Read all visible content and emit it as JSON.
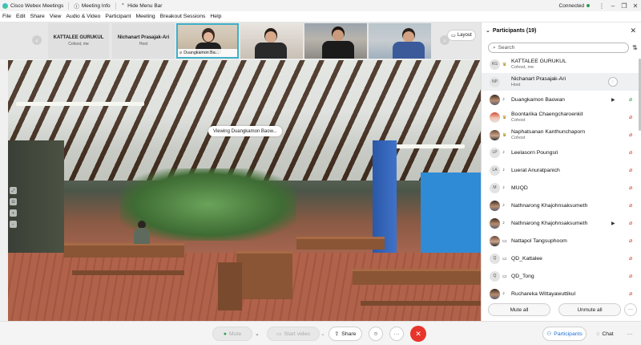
{
  "titlebar": {
    "app_title": "Cisco Webex Meetings",
    "meeting_info": "Meeting Info",
    "hide_menu_bar": "Hide Menu Bar",
    "connection_status": "Connected"
  },
  "menubar": {
    "items": [
      "File",
      "Edit",
      "Share",
      "View",
      "Audio & Video",
      "Participant",
      "Meeting",
      "Breakout Sessions",
      "Help"
    ]
  },
  "filmstrip": {
    "tiles": [
      {
        "name": "KATTALEE GURUKUL",
        "role": "Cohost, me"
      },
      {
        "name": "Nichanart Prasajak-Ari",
        "role": "Host"
      },
      {
        "name": "Duangkamon Ba..."
      }
    ],
    "layout_label": "Layout"
  },
  "stage": {
    "viewing_label": "Viewing Duangkamon Baow..."
  },
  "controls": {
    "mute_label": "Mute",
    "start_video_label": "Start video",
    "share_label": "Share",
    "participants_label": "Participants",
    "chat_label": "Chat",
    "accent_color": "#1d6fd1",
    "end_color": "#e8342a"
  },
  "panel": {
    "title": "Participants (19)",
    "search_placeholder": "Search",
    "participants": [
      {
        "initials": "KG",
        "name": "KATTALEE GURUKUL",
        "role": "Cohost, me"
      },
      {
        "initials": "NP",
        "name": "Nichanart Prasajak-Ari",
        "role": "Host"
      },
      {
        "initials": "",
        "name": "Duangkamon Baowan",
        "role": ""
      },
      {
        "initials": "",
        "name": "Boontarika Chaengcharoenkit",
        "role": "Cohost"
      },
      {
        "initials": "",
        "name": "Naphatsanan Kanthunchaporn",
        "role": "Cohost"
      },
      {
        "initials": "LP",
        "name": "Leelasorn Poungsri",
        "role": ""
      },
      {
        "initials": "LA",
        "name": "Luerat Anuratpanich",
        "role": ""
      },
      {
        "initials": "M",
        "name": "MUQD",
        "role": ""
      },
      {
        "initials": "",
        "name": "Nathnarong Khajohnsaksumeth",
        "role": ""
      },
      {
        "initials": "",
        "name": "Nathnarong Khajohnsaksumeth",
        "role": ""
      },
      {
        "initials": "",
        "name": "Nattapol Tangsuphoom",
        "role": ""
      },
      {
        "initials": "Q",
        "name": "QD_Kattalee",
        "role": ""
      },
      {
        "initials": "Q",
        "name": "QD_Tong",
        "role": ""
      },
      {
        "initials": "",
        "name": "Ruchareka Wittayawuttikul",
        "role": ""
      }
    ],
    "mute_all_label": "Mute all",
    "unmute_all_label": "Unmute all"
  }
}
